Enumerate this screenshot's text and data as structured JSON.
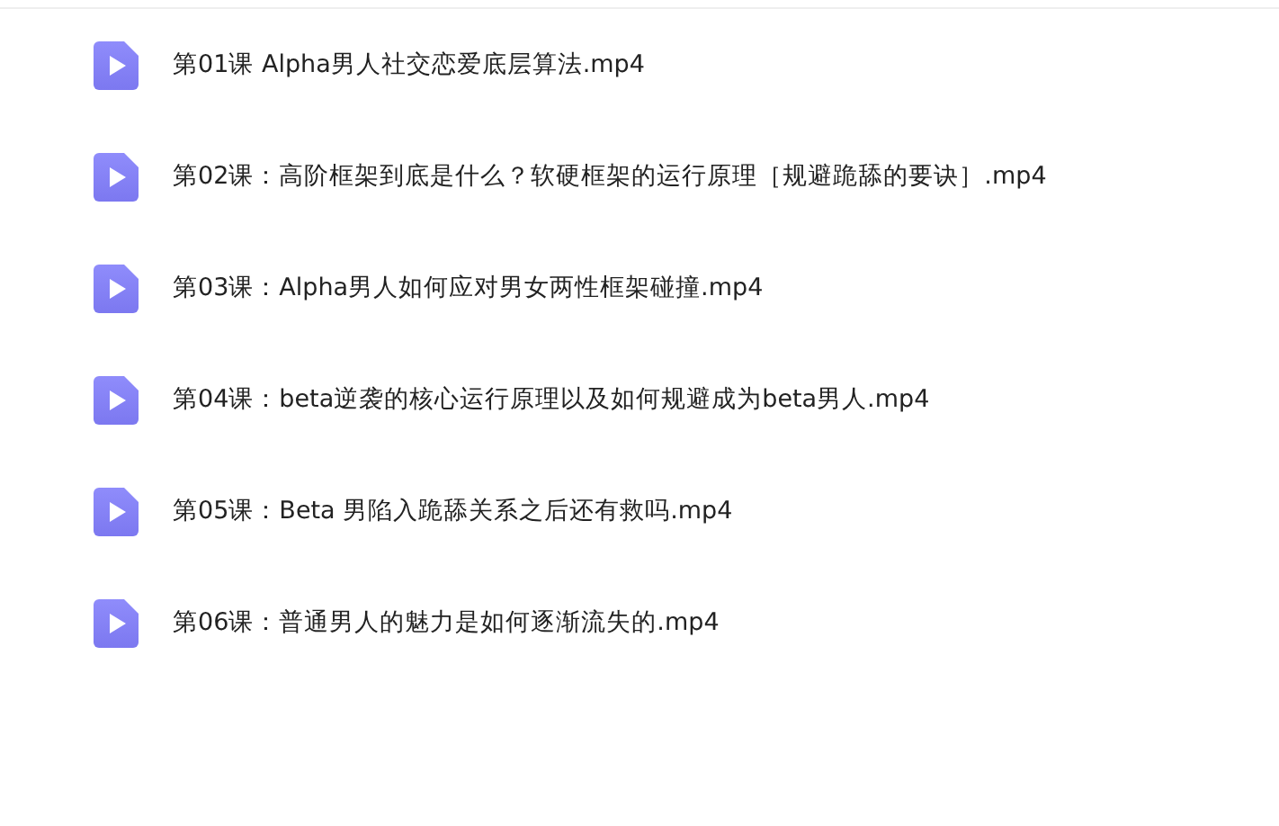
{
  "files": [
    {
      "name": "第01课 Alpha男人社交恋爱底层算法.mp4"
    },
    {
      "name": "第02课：高阶框架到底是什么？软硬框架的运行原理［规避跪舔的要诀］.mp4"
    },
    {
      "name": "第03课：Alpha男人如何应对男女两性框架碰撞.mp4"
    },
    {
      "name": "第04课：beta逆袭的核心运行原理以及如何规避成为beta男人.mp4"
    },
    {
      "name": "第05课：Beta 男陷入跪舔关系之后还有救吗.mp4"
    },
    {
      "name": "第06课：普通男人的魅力是如何逐渐流失的.mp4"
    }
  ]
}
